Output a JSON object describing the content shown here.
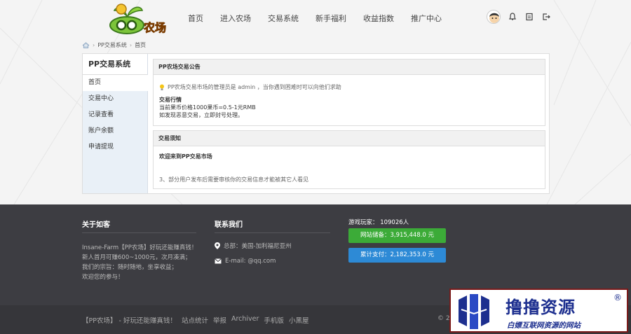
{
  "header": {
    "logo_text": "QQ农场",
    "nav": [
      "首页",
      "进入农场",
      "交易系统",
      "新手福利",
      "收益指数",
      "推广中心"
    ]
  },
  "breadcrumb": {
    "items": [
      "PP交易系统",
      "首页"
    ]
  },
  "sidebar": {
    "title": "PP交易系统",
    "items": [
      "首页",
      "交易中心",
      "记录查看",
      "账户余额",
      "申请提现"
    ]
  },
  "announcement": {
    "title": "PP农场交易公告",
    "notice": "PP农场交易市场的管理员是 admin ，当你遇到困难时可以向他们求助",
    "rules_title": "交易行情",
    "rules": [
      "当前果币价格1000果币=0.5-1元RMB",
      "如发现恶意交易，立即封号处理。"
    ]
  },
  "trade_notice": {
    "title": "交易须知",
    "welcome": "欢迎来到PP交易市场",
    "tip": "3、部分用户发布后需要审核你的交易信息才能被其它人看见"
  },
  "footer": {
    "about_title": "关于如客",
    "about_lines": [
      "Insane-Farm【PP农场】好玩还能赚真钱！",
      "新人首月可赚600~1000元，次月凑满；",
      "我们的宗旨：随时随地，坐享收益；",
      "欢迎您的参与！"
    ],
    "contact_title": "联系我们",
    "address": "总部：美国-加利福尼亚州",
    "email": "E-mail: @qq.com",
    "players_label": "游戏玩家： 109026人",
    "balance_label": "网站储备：3,915,448.0 元",
    "paid_label": "累计支付：2,182,353.0 元",
    "links": [
      "【PP农场】 - 好玩还能赚真钱！",
      "站点统计",
      "举报",
      "Archiver",
      "手机版",
      "小黑屋"
    ],
    "copyright": "© 2"
  },
  "badge": {
    "title": "撸撸资源",
    "reg": "®",
    "subtitle": "白嫖互联网资源的网站"
  },
  "colors": {
    "green": "#3cab38",
    "blue": "#2d8ad6",
    "footer_bg": "#3d3d42",
    "badge_text": "#1d2f8f"
  }
}
